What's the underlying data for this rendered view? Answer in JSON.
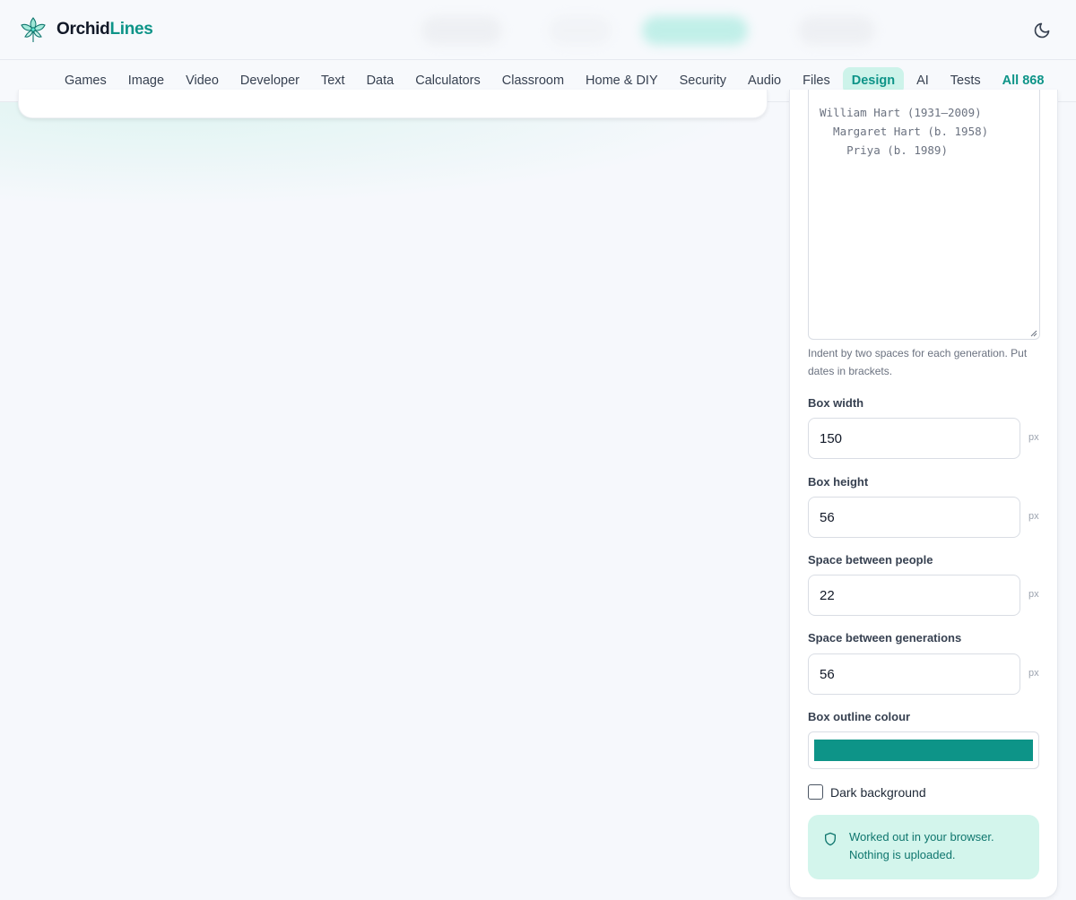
{
  "brand": {
    "name_part1": "Orchid",
    "name_part2": "Lines",
    "accent": "#0d9488"
  },
  "nav": {
    "items": [
      {
        "label": "Games"
      },
      {
        "label": "Image"
      },
      {
        "label": "Video"
      },
      {
        "label": "Developer"
      },
      {
        "label": "Text"
      },
      {
        "label": "Data"
      },
      {
        "label": "Calculators"
      },
      {
        "label": "Classroom"
      },
      {
        "label": "Home & DIY"
      },
      {
        "label": "Security"
      },
      {
        "label": "Audio"
      },
      {
        "label": "Files"
      },
      {
        "label": "Design"
      },
      {
        "label": "AI"
      },
      {
        "label": "Tests"
      },
      {
        "label": "All 868"
      }
    ],
    "active": "Design"
  },
  "panel": {
    "tree_text": "William Hart (1931–2009)\n  Margaret Hart (b. 1958)\n    Priya (b. 1989)",
    "hint": "Indent by two spaces for each generation. Put dates in brackets.",
    "box_width": {
      "label": "Box width",
      "value": "150",
      "unit": "px"
    },
    "box_height": {
      "label": "Box height",
      "value": "56",
      "unit": "px"
    },
    "space_people": {
      "label": "Space between people",
      "value": "22",
      "unit": "px"
    },
    "space_generations": {
      "label": "Space between generations",
      "value": "56",
      "unit": "px"
    },
    "outline_colour": {
      "label": "Box outline colour",
      "value": "#0d9488"
    },
    "dark_background": {
      "label": "Dark background",
      "checked": false
    },
    "notice": {
      "line1": "Worked out in your browser.",
      "line2": "Nothing is uploaded."
    }
  }
}
